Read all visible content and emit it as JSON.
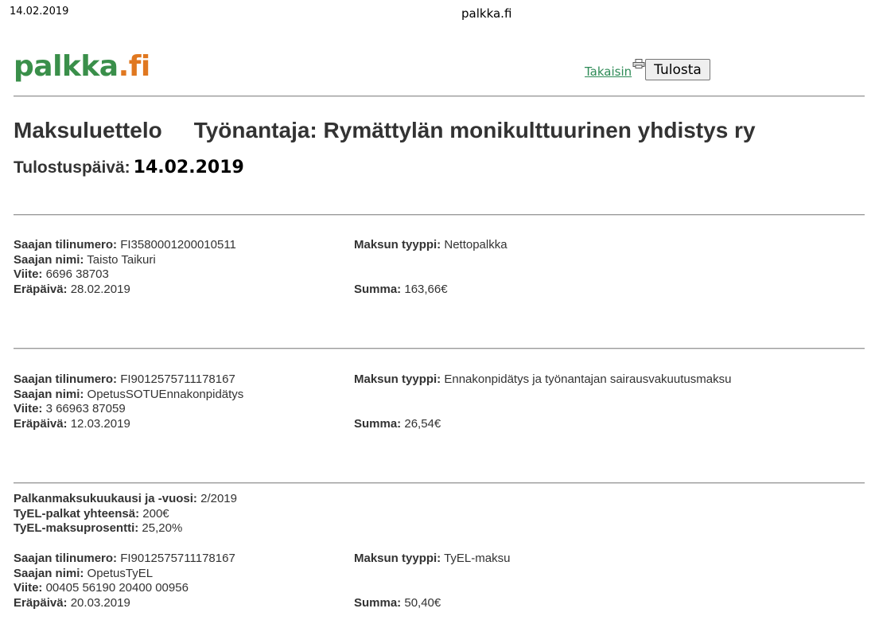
{
  "header": {
    "date": "14.02.2019",
    "site": "palkka.fi"
  },
  "logo": {
    "part1": "palkka",
    "part2": ".fi"
  },
  "nav": {
    "back_label": "Takaisin",
    "print_label": "Tulosta"
  },
  "title": {
    "heading": "Maksuluettelo",
    "employer": "Työnantaja: Rymättylän monikulttuurinen yhdistys ry",
    "print_date_label": "Tulostuspäivä:",
    "print_date": "14.02.2019"
  },
  "labels": {
    "account": "Saajan tilinumero:",
    "name": "Saajan nimi:",
    "reference": "Viite:",
    "due": "Eräpäivä:",
    "type": "Maksun tyyppi:",
    "sum": "Summa:",
    "month": "Palkanmaksukuukausi ja -vuosi:",
    "tyel_total": "TyEL-palkat yhteensä:",
    "tyel_pct": "TyEL-maksuprosentti:"
  },
  "payments": [
    {
      "account": "FI3580001200010511",
      "name": "Taisto Taikuri",
      "reference": "6696 38703",
      "due": "28.02.2019",
      "type": "Nettopalkka",
      "sum": "163,66€"
    },
    {
      "account": "FI9012575711178167",
      "name": "OpetusSOTUEnnakonpidätys",
      "reference": "3 66963 87059",
      "due": "12.03.2019",
      "type": "Ennakonpidätys ja työnantajan sairausvakuutusmaksu",
      "sum": "26,54€"
    },
    {
      "account": "FI9012575711178167",
      "name": "OpetusTyEL",
      "reference": "00405 56190 20400 00956",
      "due": "20.03.2019",
      "type": "TyEL-maksu",
      "sum": "50,40€"
    }
  ],
  "tyel": {
    "month": "2/2019",
    "total": "200€",
    "pct": "25,20%"
  }
}
